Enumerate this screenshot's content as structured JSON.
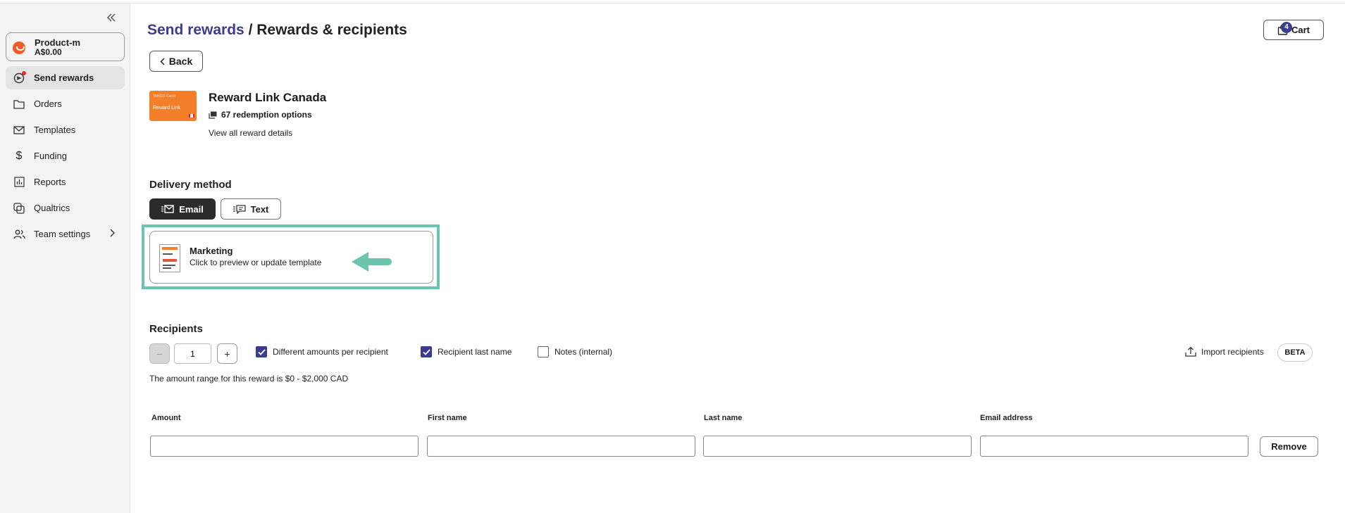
{
  "sidebar": {
    "account": {
      "name": "Product-m",
      "balance": "A$0.00"
    },
    "items": [
      {
        "label": "Send rewards",
        "icon": "send-rewards-icon",
        "active": true
      },
      {
        "label": "Orders",
        "icon": "folder-icon"
      },
      {
        "label": "Templates",
        "icon": "mail-icon"
      },
      {
        "label": "Funding",
        "icon": "dollar-icon"
      },
      {
        "label": "Reports",
        "icon": "bar-chart-icon"
      },
      {
        "label": "Qualtrics",
        "icon": "qualtrics-icon"
      },
      {
        "label": "Team settings",
        "icon": "team-icon"
      }
    ]
  },
  "header": {
    "breadcrumb_link": "Send rewards",
    "separator": " / ",
    "title": "Rewards & recipients",
    "cart_label": "Cart",
    "cart_count": "4",
    "back_label": "Back"
  },
  "reward": {
    "name": "Reward Link Canada",
    "redemption_options": "67 redemption options",
    "view_details": "View all reward details",
    "thumb_brand": "TANGO Cards",
    "thumb_label": "Reward Link"
  },
  "delivery": {
    "title": "Delivery method",
    "email_label": "Email",
    "text_label": "Text",
    "selected": "Email",
    "template_name": "Marketing",
    "template_sub": "Click to preview or update template"
  },
  "recipients": {
    "title": "Recipients",
    "count": "1",
    "options": [
      {
        "label": "Different amounts per recipient",
        "checked": true
      },
      {
        "label": "Recipient last name",
        "checked": true
      },
      {
        "label": "Notes (internal)",
        "checked": false
      }
    ],
    "import_label": "Import recipients",
    "beta_label": "BETA",
    "range_text": "The amount range for this reward is $0 - $2,000 CAD",
    "columns": [
      "Amount",
      "First name",
      "Last name",
      "Email address"
    ],
    "remove_label": "Remove"
  },
  "colors": {
    "accent": "#3d3b8e",
    "highlight": "#6cc4af",
    "brand_orange": "#f47f2b"
  }
}
